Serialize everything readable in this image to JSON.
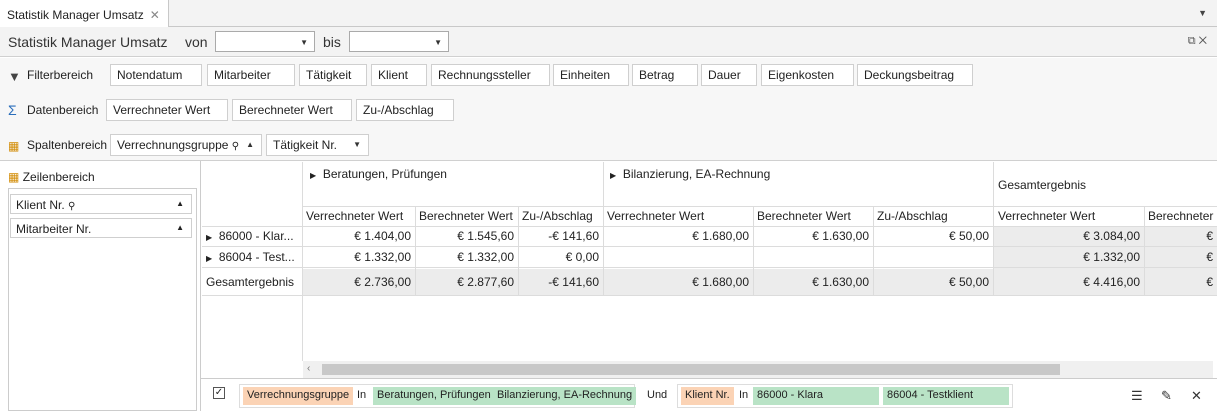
{
  "tab": {
    "title": "Statistik Manager Umsatz",
    "close": "✕",
    "menu": "▼"
  },
  "header": {
    "title": "Statistik Manager Umsatz",
    "von": "von",
    "bis": "bis",
    "von_value": "",
    "bis_value": "",
    "win_icons": "⧉ ✕"
  },
  "filter": {
    "label": "Filterbereich",
    "items": [
      "Notendatum",
      "Mitarbeiter",
      "Tätigkeit",
      "Klient",
      "Rechnungssteller",
      "Einheiten",
      "Betrag",
      "Dauer",
      "Eigenkosten",
      "Deckungsbeitrag"
    ]
  },
  "daten": {
    "label": "Datenbereich",
    "items": [
      "Verrechneter Wert",
      "Berechneter Wert",
      "Zu-/Abschlag"
    ]
  },
  "spalten": {
    "label": "Spaltenbereich",
    "items": [
      "Verrechnungsgruppe",
      "Tätigkeit Nr."
    ]
  },
  "zeilen": {
    "label": "Zeilenbereich",
    "items": [
      "Klient Nr.",
      "Mitarbeiter Nr."
    ]
  },
  "pivot": {
    "groups": [
      "Beratungen, Prüfungen",
      "Bilanzierung, EA-Rechnung",
      "Gesamtergebnis"
    ],
    "measures": [
      "Verrechneter Wert",
      "Berechneter Wert",
      "Zu-/Abschlag",
      "Verrechneter Wert",
      "Berechneter Wert",
      "Zu-/Abschlag",
      "Verrechneter Wert",
      "Berechneter"
    ],
    "rows": [
      {
        "label": "86000 - Klar...",
        "vals": [
          "€ 1.404,00",
          "€ 1.545,60",
          "-€ 141,60",
          "€ 1.680,00",
          "€ 1.630,00",
          "€ 50,00",
          "€ 3.084,00",
          "€"
        ]
      },
      {
        "label": "86004 - Test...",
        "vals": [
          "€ 1.332,00",
          "€ 1.332,00",
          "€ 0,00",
          "",
          "",
          "",
          "€ 1.332,00",
          "€"
        ]
      },
      {
        "label": "Gesamtergebnis",
        "vals": [
          "€ 2.736,00",
          "€ 2.877,60",
          "-€ 141,60",
          "€ 1.680,00",
          "€ 1.630,00",
          "€ 50,00",
          "€ 4.416,00",
          "€"
        ]
      }
    ]
  },
  "footer": {
    "field1": "Verrechnungsgruppe",
    "in1": "In",
    "v1": "Beratungen, Prüfungen",
    "v2": "Bilanzierung, EA-Rechnung",
    "und": "Und",
    "field2": "Klient Nr.",
    "in2": "In",
    "v3": "86000 - Klara",
    "v4": "86004 - Testklient"
  },
  "colors": {
    "orange": "#fbd3b5",
    "green": "#b9e3c6",
    "total": "#ececec"
  }
}
